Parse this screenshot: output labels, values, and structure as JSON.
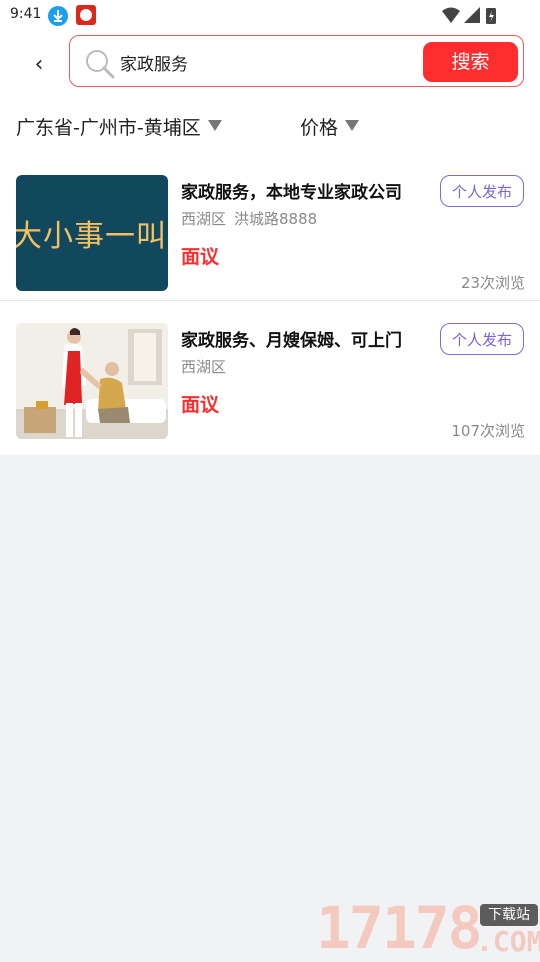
{
  "status_bar": {
    "time": "9:41",
    "icons": [
      "download-icon",
      "app-notification-icon",
      "wifi-icon",
      "signal-icon",
      "battery-icon"
    ]
  },
  "header": {
    "back_label": "‹",
    "search": {
      "value": "家政服务",
      "button_label": "搜索"
    }
  },
  "filters": {
    "region": "广东省-广州市-黄埔区",
    "price": "价格"
  },
  "listings": [
    {
      "title": "家政服务，本地专业家政公司",
      "district": "西湖区",
      "address": "洪城路8888",
      "price": "面议",
      "tag": "个人发布",
      "views": "23次浏览",
      "thumb_text": "大小事一叫"
    },
    {
      "title": "家政服务、月嫂保姆、可上门",
      "district": "西湖区",
      "address": "",
      "price": "面议",
      "tag": "个人发布",
      "views": "107次浏览"
    }
  ],
  "watermark": {
    "number": "17178",
    "tag": "下载站",
    "suffix": ".COM"
  },
  "colors": {
    "accent": "#ff2d2d",
    "tag": "#7c65d6",
    "thumb_bg": "#11485d",
    "thumb_text": "#f5c062"
  }
}
